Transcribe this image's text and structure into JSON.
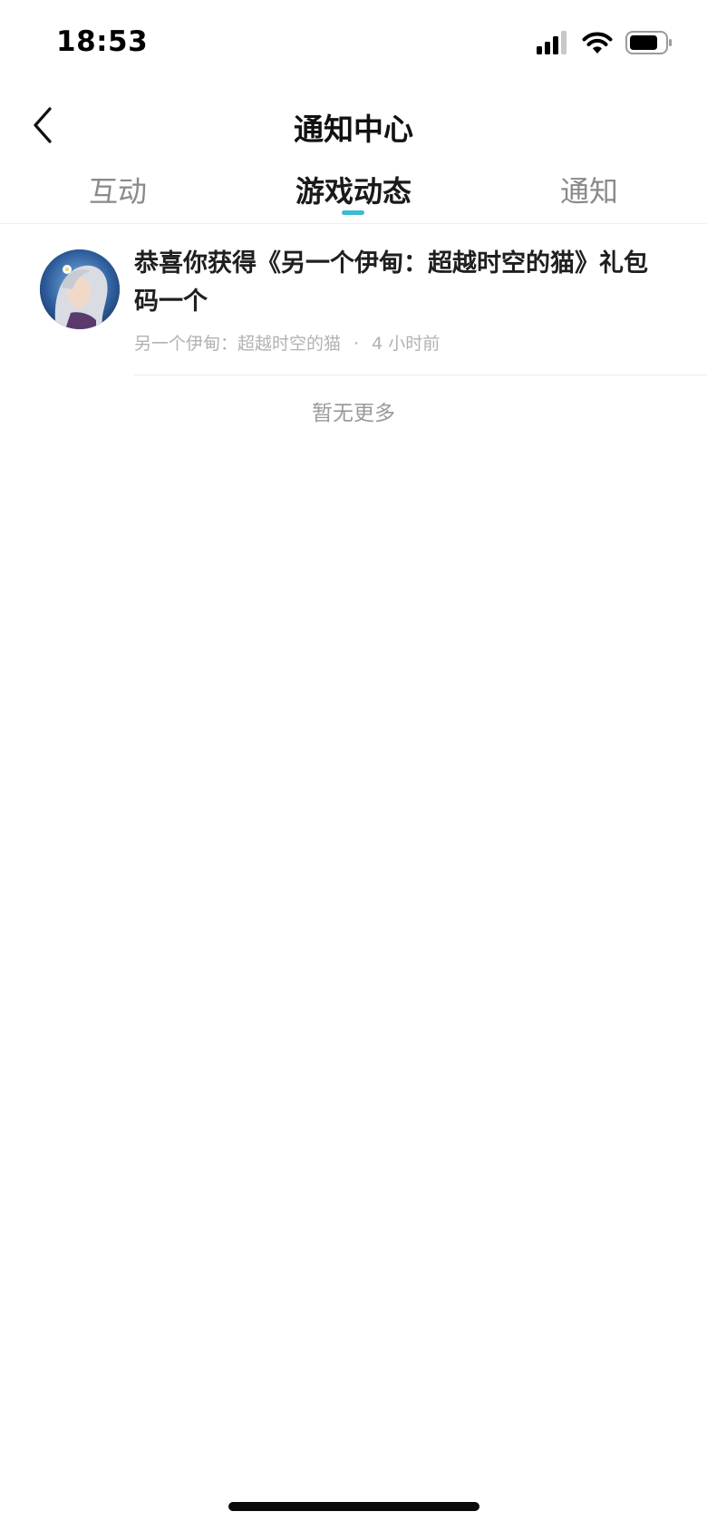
{
  "status_bar": {
    "time": "18:53"
  },
  "header": {
    "title": "通知中心",
    "back_icon": "chevron-left-icon"
  },
  "tabs": [
    {
      "label": "互动",
      "active": false
    },
    {
      "label": "游戏动态",
      "active": true
    },
    {
      "label": "通知",
      "active": false
    }
  ],
  "accent_color": "#3cbad0",
  "notifications": [
    {
      "title": "恭喜你获得《另一个伊甸：超越时空的猫》礼包码一个",
      "source": "另一个伊甸：超越时空的猫",
      "separator": "·",
      "time": "4 小时前"
    }
  ],
  "footer_text": "暂无更多"
}
